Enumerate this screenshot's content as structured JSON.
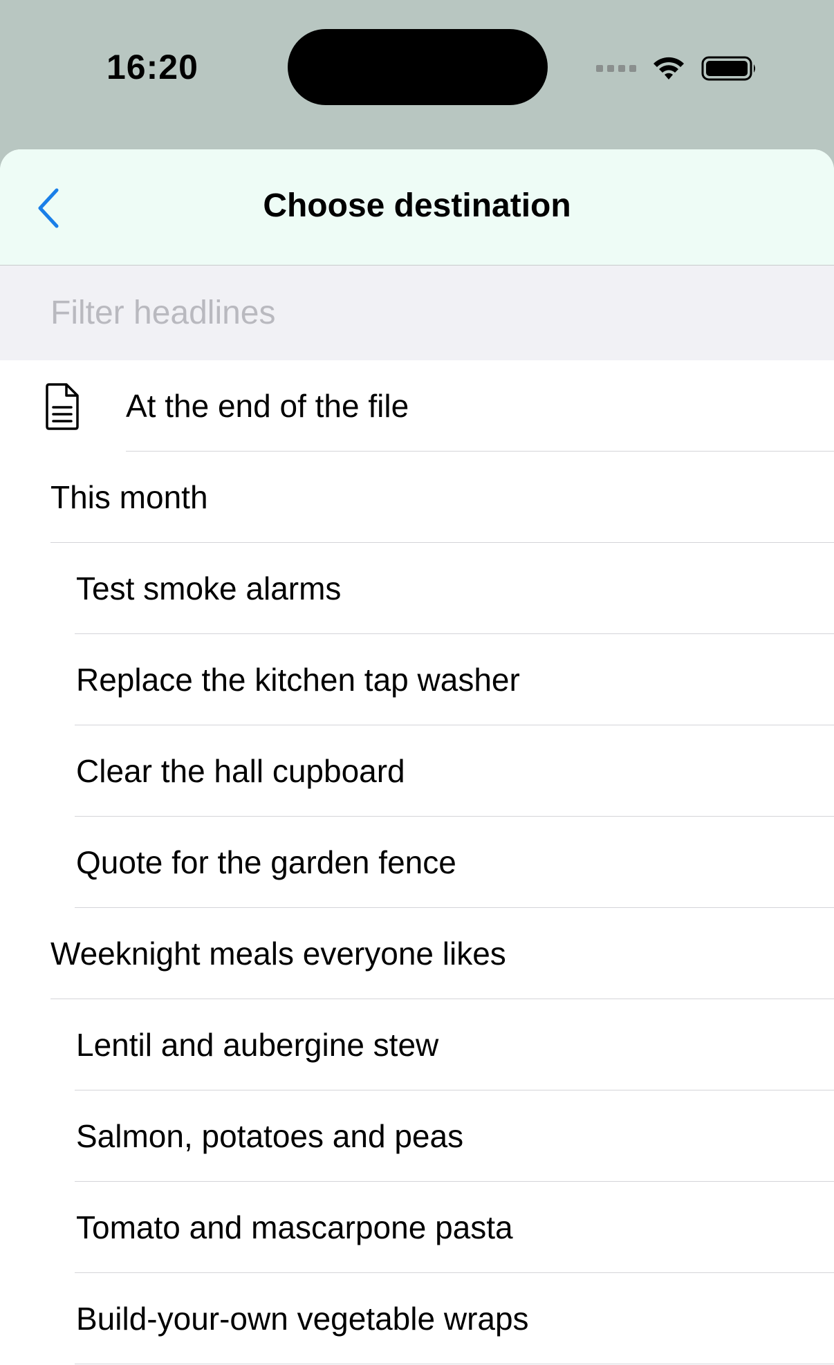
{
  "status": {
    "time": "16:20"
  },
  "colors": {
    "accent": "#1a7fe8",
    "nav_background": "#eefcf6",
    "filter_background": "#f1f1f5",
    "backdrop": "#b8c6c1"
  },
  "nav": {
    "title": "Choose destination",
    "back_icon": "chevron-left-icon"
  },
  "filter": {
    "placeholder": "Filter headlines",
    "value": ""
  },
  "list": {
    "end_of_file": {
      "label": "At the end of the file",
      "icon": "document-icon"
    },
    "items": [
      {
        "label": "This month",
        "level": 1
      },
      {
        "label": "Test smoke alarms",
        "level": 2
      },
      {
        "label": "Replace the kitchen tap washer",
        "level": 2
      },
      {
        "label": "Clear the hall cupboard",
        "level": 2
      },
      {
        "label": "Quote for the garden fence",
        "level": 2
      },
      {
        "label": "Weeknight meals everyone likes",
        "level": 1
      },
      {
        "label": "Lentil and aubergine stew",
        "level": 2
      },
      {
        "label": "Salmon, potatoes and peas",
        "level": 2
      },
      {
        "label": "Tomato and mascarpone pasta",
        "level": 2
      },
      {
        "label": "Build-your-own vegetable wraps",
        "level": 2
      }
    ]
  }
}
